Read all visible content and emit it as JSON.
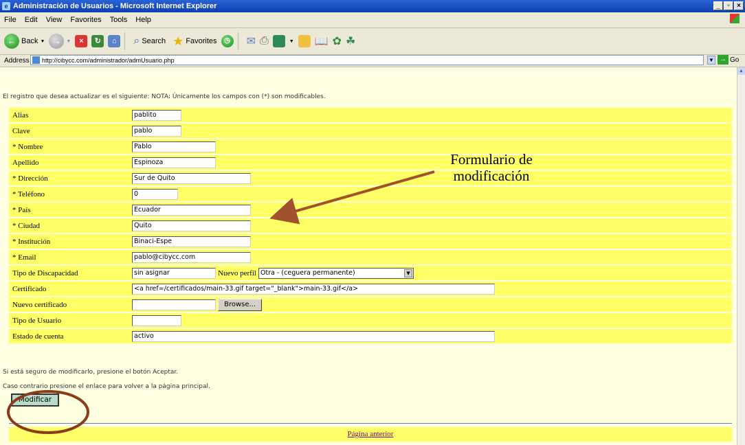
{
  "window": {
    "title": "Administración de Usuarios - Microsoft Internet Explorer",
    "buttons": [
      "_",
      "©",
      "x"
    ]
  },
  "menu": [
    "File",
    "Edit",
    "View",
    "Favorites",
    "Tools",
    "Help"
  ],
  "toolbar": {
    "back_label": "Back",
    "search_label": "Search",
    "favorites_label": "Favorites"
  },
  "address": {
    "label": "Address",
    "url": "http://cibycc.com/administrador/admUsuario.php",
    "go_label": "Go"
  },
  "page": {
    "intro": "El registro que desea actualizar es el siguiente: NOTA: Únicamente los campos con (*) son modificables.",
    "fields": [
      {
        "label": "Alias",
        "value": "pablito"
      },
      {
        "label": "Clave",
        "value": "pablo"
      },
      {
        "label": "* Nombre",
        "value": "Pablo"
      },
      {
        "label": "Apellido",
        "value": "Espinoza"
      },
      {
        "label": "* Dirección",
        "value": "Sur de Quito"
      },
      {
        "label": "* Teléfono",
        "value": "0"
      },
      {
        "label": "* País",
        "value": "Ecuador"
      },
      {
        "label": "* Ciudad",
        "value": "Quito"
      },
      {
        "label": "* Institución",
        "value": "Binaci-Espe"
      },
      {
        "label": "* Email",
        "value": "pablo@cibycc.com"
      },
      {
        "label": "Tipo de Discapacidad",
        "value": "sin asignar"
      },
      {
        "label": "Certificado",
        "value": "<a href=/certificados/main-33.gif target=\"_blank\">main-33.gif</a>"
      },
      {
        "label": "Nuevo certificado",
        "value": ""
      },
      {
        "label": "Tipo de Usuario",
        "value": ""
      },
      {
        "label": "Estado de cuenta",
        "value": "activo"
      }
    ],
    "nuevo_perfil_label": "Nuevo perfil",
    "nuevo_perfil_selected": "Otra - (ceguera permanente)",
    "browse_label": "Browse...",
    "note1": "Si está seguro de modificarlo, presione el botón Aceptar.",
    "note2": "Caso contrario presione el enlace para volver a la página principal.",
    "submit_label": "Modificar",
    "back_link": "Página anterior"
  },
  "annotation": {
    "line1": "Formulario de",
    "line2": "modificación",
    "color": "#a0522d"
  }
}
